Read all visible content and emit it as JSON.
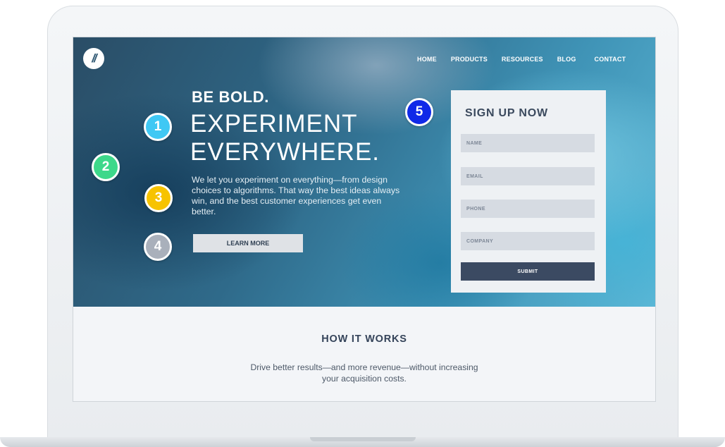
{
  "brand": {
    "logo_text": "//"
  },
  "nav": {
    "items": [
      "HOME",
      "PRODUCTS",
      "RESOURCES",
      "BLOG",
      "CONTACT"
    ]
  },
  "hero": {
    "eyebrow": "BE BOLD.",
    "headline_line1": "EXPERIMENT",
    "headline_line2": "EVERYWHERE.",
    "description": "We let you experiment on everything—from design choices to algorithms. That way the best ideas always win, and the best customer experiences get even better.",
    "cta_label": "LEARN MORE"
  },
  "signup": {
    "title": "SIGN UP NOW",
    "fields": [
      {
        "placeholder": "NAME"
      },
      {
        "placeholder": "EMAIL"
      },
      {
        "placeholder": "PHONE"
      },
      {
        "placeholder": "COMPANY"
      }
    ],
    "submit_label": "SUBMIT"
  },
  "how_it_works": {
    "title": "HOW IT WORKS",
    "description": "Drive better results—and more revenue—without increasing your acquisition costs."
  },
  "markers": [
    {
      "label": "1",
      "color": "#3fc8f4"
    },
    {
      "label": "2",
      "color": "#3dd88a"
    },
    {
      "label": "3",
      "color": "#f7c300"
    },
    {
      "label": "4",
      "color": "#a9b0bb"
    },
    {
      "label": "5",
      "color": "#1029e8"
    }
  ],
  "colors": {
    "card_background": "#eef1f4",
    "submit_button": "#3b4a62",
    "learn_more_button": "#dfe2e6",
    "heading_text": "#35445a"
  }
}
